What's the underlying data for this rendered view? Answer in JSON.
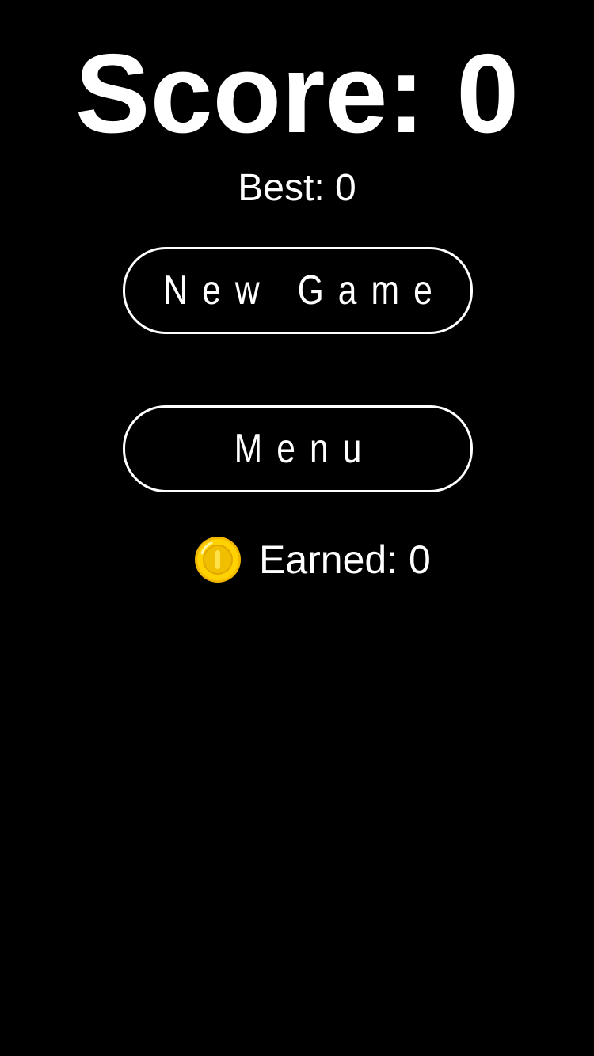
{
  "score": {
    "label": "Score: 0",
    "value": 0
  },
  "best": {
    "label": "Best: 0",
    "value": 0
  },
  "buttons": {
    "new_game": "New Game",
    "menu": "Menu"
  },
  "earned": {
    "icon": "coin-icon",
    "label": "Earned: 0",
    "value": 0
  },
  "colors": {
    "background": "#000000",
    "text": "#ffffff",
    "coin": "#f5c800"
  }
}
